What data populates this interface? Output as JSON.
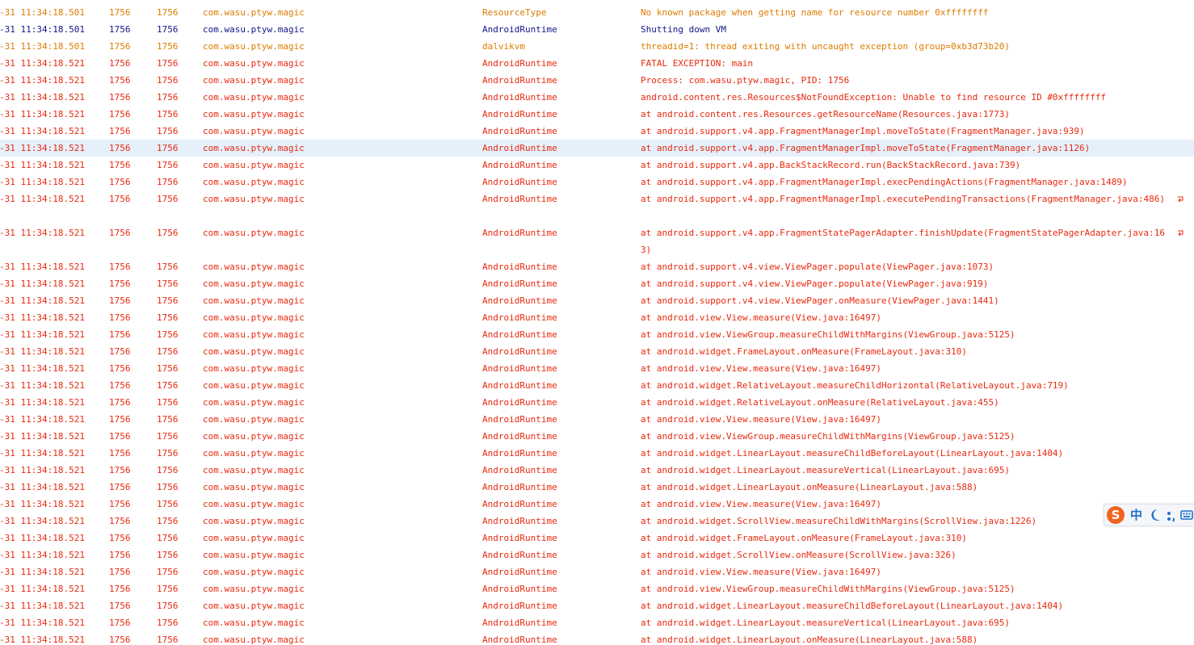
{
  "colors": {
    "warning": "#dd7b00",
    "info": "#14148a",
    "error": "#e8290f",
    "selected_row": "#e6f0fb",
    "ime_accent": "#f0641e"
  },
  "log": {
    "rows": [
      {
        "time": "-31 11:34:18.501",
        "pid": "1756",
        "tid": "1756",
        "app": "com.wasu.ptyw.magic",
        "tag": "ResourceType",
        "text": "No known package when getting name for resource number 0xffffffff",
        "level": "warning"
      },
      {
        "time": "-31 11:34:18.501",
        "pid": "1756",
        "tid": "1756",
        "app": "com.wasu.ptyw.magic",
        "tag": "AndroidRuntime",
        "text": "Shutting down VM",
        "level": "info"
      },
      {
        "time": "-31 11:34:18.501",
        "pid": "1756",
        "tid": "1756",
        "app": "com.wasu.ptyw.magic",
        "tag": "dalvikvm",
        "text": "threadid=1: thread exiting with uncaught exception (group=0xb3d73b20)",
        "level": "warning"
      },
      {
        "time": "-31 11:34:18.521",
        "pid": "1756",
        "tid": "1756",
        "app": "com.wasu.ptyw.magic",
        "tag": "AndroidRuntime",
        "text": "FATAL EXCEPTION: main",
        "level": "error"
      },
      {
        "time": "-31 11:34:18.521",
        "pid": "1756",
        "tid": "1756",
        "app": "com.wasu.ptyw.magic",
        "tag": "AndroidRuntime",
        "text": "Process: com.wasu.ptyw.magic, PID: 1756",
        "level": "error"
      },
      {
        "time": "-31 11:34:18.521",
        "pid": "1756",
        "tid": "1756",
        "app": "com.wasu.ptyw.magic",
        "tag": "AndroidRuntime",
        "text": "android.content.res.Resources$NotFoundException: Unable to find resource ID #0xffffffff",
        "level": "error"
      },
      {
        "time": "-31 11:34:18.521",
        "pid": "1756",
        "tid": "1756",
        "app": "com.wasu.ptyw.magic",
        "tag": "AndroidRuntime",
        "text": "at android.content.res.Resources.getResourceName(Resources.java:1773)",
        "level": "error"
      },
      {
        "time": "-31 11:34:18.521",
        "pid": "1756",
        "tid": "1756",
        "app": "com.wasu.ptyw.magic",
        "tag": "AndroidRuntime",
        "text": "at android.support.v4.app.FragmentManagerImpl.moveToState(FragmentManager.java:939)",
        "level": "error"
      },
      {
        "time": "-31 11:34:18.521",
        "pid": "1756",
        "tid": "1756",
        "app": "com.wasu.ptyw.magic",
        "tag": "AndroidRuntime",
        "text": "at android.support.v4.app.FragmentManagerImpl.moveToState(FragmentManager.java:1126)",
        "level": "error",
        "selected": true
      },
      {
        "time": "-31 11:34:18.521",
        "pid": "1756",
        "tid": "1756",
        "app": "com.wasu.ptyw.magic",
        "tag": "AndroidRuntime",
        "text": "at android.support.v4.app.BackStackRecord.run(BackStackRecord.java:739)",
        "level": "error"
      },
      {
        "time": "-31 11:34:18.521",
        "pid": "1756",
        "tid": "1756",
        "app": "com.wasu.ptyw.magic",
        "tag": "AndroidRuntime",
        "text": "at android.support.v4.app.FragmentManagerImpl.execPendingActions(FragmentManager.java:1489)",
        "level": "error"
      },
      {
        "time": "-31 11:34:18.521",
        "pid": "1756",
        "tid": "1756",
        "app": "com.wasu.ptyw.magic",
        "tag": "AndroidRuntime",
        "text": "at android.support.v4.app.FragmentManagerImpl.executePendingTransactions(FragmentManager.java:486)",
        "level": "error",
        "wrapped": true
      },
      {
        "time": "-31 11:34:18.521",
        "pid": "1756",
        "tid": "1756",
        "app": "com.wasu.ptyw.magic",
        "tag": "AndroidRuntime",
        "text": "at android.support.v4.app.FragmentStatePagerAdapter.finishUpdate(FragmentStatePagerAdapter.java:163)",
        "level": "error",
        "wrapped": true
      },
      {
        "time": "-31 11:34:18.521",
        "pid": "1756",
        "tid": "1756",
        "app": "com.wasu.ptyw.magic",
        "tag": "AndroidRuntime",
        "text": "at android.support.v4.view.ViewPager.populate(ViewPager.java:1073)",
        "level": "error"
      },
      {
        "time": "-31 11:34:18.521",
        "pid": "1756",
        "tid": "1756",
        "app": "com.wasu.ptyw.magic",
        "tag": "AndroidRuntime",
        "text": "at android.support.v4.view.ViewPager.populate(ViewPager.java:919)",
        "level": "error"
      },
      {
        "time": "-31 11:34:18.521",
        "pid": "1756",
        "tid": "1756",
        "app": "com.wasu.ptyw.magic",
        "tag": "AndroidRuntime",
        "text": "at android.support.v4.view.ViewPager.onMeasure(ViewPager.java:1441)",
        "level": "error"
      },
      {
        "time": "-31 11:34:18.521",
        "pid": "1756",
        "tid": "1756",
        "app": "com.wasu.ptyw.magic",
        "tag": "AndroidRuntime",
        "text": "at android.view.View.measure(View.java:16497)",
        "level": "error"
      },
      {
        "time": "-31 11:34:18.521",
        "pid": "1756",
        "tid": "1756",
        "app": "com.wasu.ptyw.magic",
        "tag": "AndroidRuntime",
        "text": "at android.view.ViewGroup.measureChildWithMargins(ViewGroup.java:5125)",
        "level": "error"
      },
      {
        "time": "-31 11:34:18.521",
        "pid": "1756",
        "tid": "1756",
        "app": "com.wasu.ptyw.magic",
        "tag": "AndroidRuntime",
        "text": "at android.widget.FrameLayout.onMeasure(FrameLayout.java:310)",
        "level": "error"
      },
      {
        "time": "-31 11:34:18.521",
        "pid": "1756",
        "tid": "1756",
        "app": "com.wasu.ptyw.magic",
        "tag": "AndroidRuntime",
        "text": "at android.view.View.measure(View.java:16497)",
        "level": "error"
      },
      {
        "time": "-31 11:34:18.521",
        "pid": "1756",
        "tid": "1756",
        "app": "com.wasu.ptyw.magic",
        "tag": "AndroidRuntime",
        "text": "at android.widget.RelativeLayout.measureChildHorizontal(RelativeLayout.java:719)",
        "level": "error"
      },
      {
        "time": "-31 11:34:18.521",
        "pid": "1756",
        "tid": "1756",
        "app": "com.wasu.ptyw.magic",
        "tag": "AndroidRuntime",
        "text": "at android.widget.RelativeLayout.onMeasure(RelativeLayout.java:455)",
        "level": "error"
      },
      {
        "time": "-31 11:34:18.521",
        "pid": "1756",
        "tid": "1756",
        "app": "com.wasu.ptyw.magic",
        "tag": "AndroidRuntime",
        "text": "at android.view.View.measure(View.java:16497)",
        "level": "error"
      },
      {
        "time": "-31 11:34:18.521",
        "pid": "1756",
        "tid": "1756",
        "app": "com.wasu.ptyw.magic",
        "tag": "AndroidRuntime",
        "text": "at android.view.ViewGroup.measureChildWithMargins(ViewGroup.java:5125)",
        "level": "error"
      },
      {
        "time": "-31 11:34:18.521",
        "pid": "1756",
        "tid": "1756",
        "app": "com.wasu.ptyw.magic",
        "tag": "AndroidRuntime",
        "text": "at android.widget.LinearLayout.measureChildBeforeLayout(LinearLayout.java:1404)",
        "level": "error"
      },
      {
        "time": "-31 11:34:18.521",
        "pid": "1756",
        "tid": "1756",
        "app": "com.wasu.ptyw.magic",
        "tag": "AndroidRuntime",
        "text": "at android.widget.LinearLayout.measureVertical(LinearLayout.java:695)",
        "level": "error"
      },
      {
        "time": "-31 11:34:18.521",
        "pid": "1756",
        "tid": "1756",
        "app": "com.wasu.ptyw.magic",
        "tag": "AndroidRuntime",
        "text": "at android.widget.LinearLayout.onMeasure(LinearLayout.java:588)",
        "level": "error"
      },
      {
        "time": "-31 11:34:18.521",
        "pid": "1756",
        "tid": "1756",
        "app": "com.wasu.ptyw.magic",
        "tag": "AndroidRuntime",
        "text": "at android.view.View.measure(View.java:16497)",
        "level": "error"
      },
      {
        "time": "-31 11:34:18.521",
        "pid": "1756",
        "tid": "1756",
        "app": "com.wasu.ptyw.magic",
        "tag": "AndroidRuntime",
        "text": "at android.widget.ScrollView.measureChildWithMargins(ScrollView.java:1226)",
        "level": "error"
      },
      {
        "time": "-31 11:34:18.521",
        "pid": "1756",
        "tid": "1756",
        "app": "com.wasu.ptyw.magic",
        "tag": "AndroidRuntime",
        "text": "at android.widget.FrameLayout.onMeasure(FrameLayout.java:310)",
        "level": "error"
      },
      {
        "time": "-31 11:34:18.521",
        "pid": "1756",
        "tid": "1756",
        "app": "com.wasu.ptyw.magic",
        "tag": "AndroidRuntime",
        "text": "at android.widget.ScrollView.onMeasure(ScrollView.java:326)",
        "level": "error"
      },
      {
        "time": "-31 11:34:18.521",
        "pid": "1756",
        "tid": "1756",
        "app": "com.wasu.ptyw.magic",
        "tag": "AndroidRuntime",
        "text": "at android.view.View.measure(View.java:16497)",
        "level": "error"
      },
      {
        "time": "-31 11:34:18.521",
        "pid": "1756",
        "tid": "1756",
        "app": "com.wasu.ptyw.magic",
        "tag": "AndroidRuntime",
        "text": "at android.view.ViewGroup.measureChildWithMargins(ViewGroup.java:5125)",
        "level": "error"
      },
      {
        "time": "-31 11:34:18.521",
        "pid": "1756",
        "tid": "1756",
        "app": "com.wasu.ptyw.magic",
        "tag": "AndroidRuntime",
        "text": "at android.widget.LinearLayout.measureChildBeforeLayout(LinearLayout.java:1404)",
        "level": "error"
      },
      {
        "time": "-31 11:34:18.521",
        "pid": "1756",
        "tid": "1756",
        "app": "com.wasu.ptyw.magic",
        "tag": "AndroidRuntime",
        "text": "at android.widget.LinearLayout.measureVertical(LinearLayout.java:695)",
        "level": "error"
      },
      {
        "time": "-31 11:34:18.521",
        "pid": "1756",
        "tid": "1756",
        "app": "com.wasu.ptyw.magic",
        "tag": "AndroidRuntime",
        "text": "at android.widget.LinearLayout.onMeasure(LinearLayout.java:588)",
        "level": "error"
      }
    ]
  },
  "ime": {
    "logo": "S",
    "mode": "中",
    "icons": [
      "sogou-logo-icon",
      "moon-icon",
      "punctuation-icon",
      "keyboard-icon"
    ]
  }
}
